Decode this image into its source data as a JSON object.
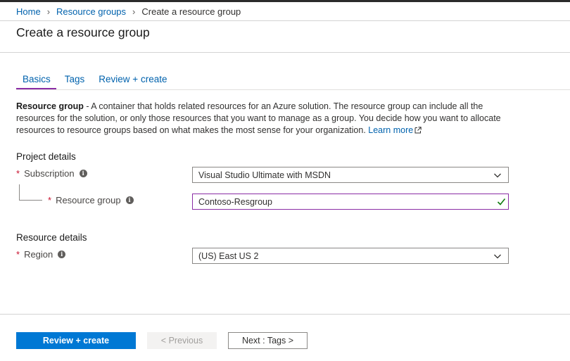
{
  "breadcrumb": {
    "home": "Home",
    "resource_groups": "Resource groups",
    "current": "Create a resource group"
  },
  "page": {
    "title": "Create a resource group"
  },
  "tabs": [
    {
      "label": "Basics",
      "active": true
    },
    {
      "label": "Tags",
      "active": false
    },
    {
      "label": "Review + create",
      "active": false
    }
  ],
  "description": {
    "bold": "Resource group",
    "text": " - A container that holds related resources for an Azure solution. The resource group can include all the resources for the solution, or only those resources that you want to manage as a group. You decide how you want to allocate resources to resource groups based on what makes the most sense for your organization. ",
    "link": "Learn more"
  },
  "project_details": {
    "title": "Project details",
    "subscription": {
      "label": "Subscription",
      "value": "Visual Studio Ultimate with MSDN"
    },
    "resource_group": {
      "label": "Resource group",
      "value": "Contoso-Resgroup"
    }
  },
  "resource_details": {
    "title": "Resource details",
    "region": {
      "label": "Region",
      "value": "(US) East US 2"
    }
  },
  "required_marker": "*",
  "info_glyph": "i",
  "footer": {
    "review_create": "Review + create",
    "previous": "< Previous",
    "next": "Next : Tags >"
  },
  "colors": {
    "accent": "#0078d4",
    "link": "#0062ad",
    "active_tab_underline": "#8a2da5",
    "required": "#c8102e",
    "valid_check": "#107c10"
  },
  "icons": {
    "chevron": "chevron-down-icon",
    "check": "checkmark-icon",
    "info": "info-icon",
    "external": "external-link-icon"
  }
}
